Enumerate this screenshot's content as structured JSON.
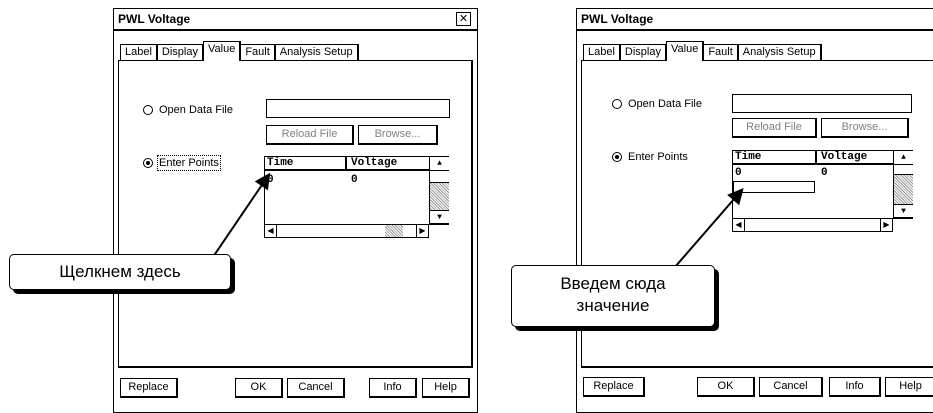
{
  "dialog_left": {
    "title": "PWL Voltage",
    "close_glyph": "✕",
    "tabs": [
      "Label",
      "Display",
      "Value",
      "Fault",
      "Analysis Setup"
    ],
    "active_tab": "Value",
    "open_data_file_label": "Open Data File",
    "reload_file_label": "Reload File",
    "browse_label": "Browse...",
    "enter_points_label": "Enter Points",
    "time_header": "Time",
    "voltage_header": "Voltage",
    "row_time": "0",
    "row_voltage": "0",
    "buttons": {
      "replace": "Replace",
      "ok": "OK",
      "cancel": "Cancel",
      "info": "Info",
      "help": "Help"
    }
  },
  "dialog_right": {
    "title": "PWL Voltage",
    "tabs": [
      "Label",
      "Display",
      "Value",
      "Fault",
      "Analysis Setup"
    ],
    "active_tab": "Value",
    "open_data_file_label": "Open Data File",
    "reload_file_label": "Reload File",
    "browse_label": "Browse...",
    "enter_points_label": "Enter Points",
    "time_header": "Time",
    "voltage_header": "Voltage",
    "row_time": "0",
    "row_voltage": "0",
    "buttons": {
      "replace": "Replace",
      "ok": "OK",
      "cancel": "Cancel",
      "info": "Info",
      "help": "Help"
    }
  },
  "callouts": {
    "left": "Щелкнем здесь",
    "right_line1": "Введем сюда",
    "right_line2": "значение"
  },
  "icons": {
    "close": "close-icon",
    "scroll_up": "scroll-up-arrow-icon",
    "scroll_down": "scroll-down-arrow-icon",
    "scroll_left": "scroll-left-arrow-icon",
    "scroll_right": "scroll-right-arrow-icon"
  }
}
